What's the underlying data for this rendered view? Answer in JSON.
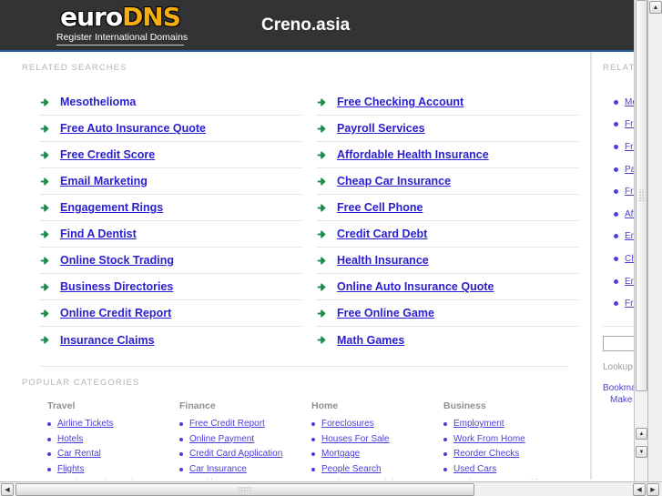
{
  "header": {
    "logo_primary": "euro",
    "logo_secondary": "DNS",
    "logo_tagline": "Register International Domains",
    "site_title": "Creno.asia"
  },
  "main": {
    "related_searches_label": "RELATED SEARCHES",
    "related_searches": {
      "left_column": [
        "Mesothelioma",
        "Free Auto Insurance Quote",
        "Free Credit Score",
        "Email Marketing",
        "Engagement Rings",
        "Find A Dentist",
        "Online Stock Trading",
        "Business Directories",
        "Online Credit Report",
        "Insurance Claims"
      ],
      "right_column": [
        "Free Checking Account",
        "Payroll Services",
        "Affordable Health Insurance",
        "Cheap Car Insurance",
        "Free Cell Phone",
        "Credit Card Debt",
        "Health Insurance",
        "Online Auto Insurance Quote",
        "Free Online Game",
        "Math Games"
      ]
    },
    "popular_categories_label": "POPULAR CATEGORIES",
    "popular_categories": [
      {
        "heading": "Travel",
        "items": [
          "Airline Tickets",
          "Hotels",
          "Car Rental",
          "Flights",
          "South Beach Hotels"
        ]
      },
      {
        "heading": "Finance",
        "items": [
          "Free Credit Report",
          "Online Payment",
          "Credit Card Application",
          "Car Insurance",
          "Health Insurance"
        ]
      },
      {
        "heading": "Home",
        "items": [
          "Foreclosures",
          "Houses For Sale",
          "Mortgage",
          "People Search",
          "Real Estate Training"
        ]
      },
      {
        "heading": "Business",
        "items": [
          "Employment",
          "Work From Home",
          "Reorder Checks",
          "Used Cars",
          "Business Opportunities"
        ]
      }
    ]
  },
  "sidebar": {
    "label": "RELATED",
    "items": [
      "Me",
      "Fre",
      "Fre",
      "Pay",
      "Fre",
      "Aff",
      "Em",
      "Ch",
      "Eng",
      "Fre"
    ],
    "search_value": "",
    "search_placeholder": "",
    "lookup_text": "Lookup WH",
    "bookmark_label": "Bookmark",
    "make_home_label": "Make this"
  },
  "scrollbars": {
    "up_arrow": "▲",
    "down_arrow": "▼",
    "left_arrow": "◀",
    "right_arrow": "▶"
  },
  "colors": {
    "header_bg": "#333234",
    "header_rule": "#2a5b9c",
    "logo_accent": "#f6ad12",
    "link": "#2b20cf",
    "link_small": "#4a3fd6",
    "bullet_green": "#1f8a4c",
    "label_gray": "#b4b4b4",
    "divider": "#dbe6f2"
  }
}
